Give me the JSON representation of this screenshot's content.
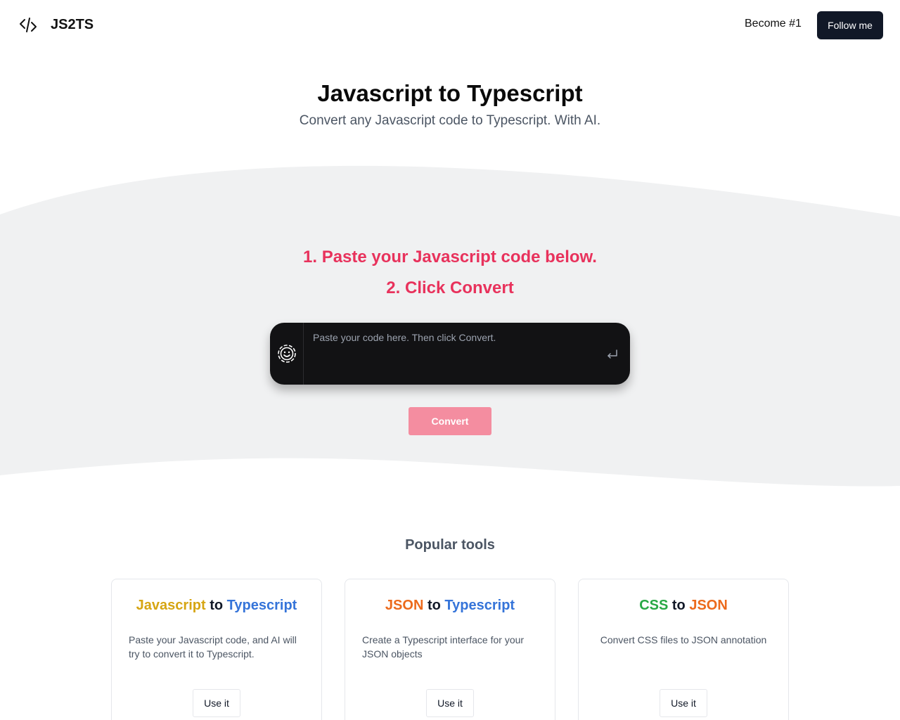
{
  "header": {
    "logo_text": "JS2TS",
    "nav_link": "Become #1",
    "follow_label": "Follow me",
    "follow_bg": "#111827"
  },
  "hero": {
    "title": "Javascript to Typescript",
    "subtitle": "Convert any Javascript code to Typescript. With AI."
  },
  "instructions": {
    "step1": "1. Paste your Javascript code below.",
    "step2": "2. Click Convert",
    "color": "#e8325c"
  },
  "editor": {
    "placeholder": "Paste your code here. Then click Convert.",
    "value": "",
    "left_icon": "smile-icon",
    "submit_icon": "enter-icon"
  },
  "convert": {
    "label": "Convert",
    "bg": "#f48da0"
  },
  "band_color": "#f0f1f2",
  "popular": {
    "title": "Popular tools",
    "cards": [
      {
        "from": "Javascript",
        "from_color": "#d6a512",
        "to_word": "to",
        "target": "Typescript",
        "target_color": "#3574d9",
        "desc": "Paste your Javascript code, and AI will try to convert it to Typescript.",
        "button": "Use it"
      },
      {
        "from": "JSON",
        "from_color": "#ec6a1c",
        "to_word": "to",
        "target": "Typescript",
        "target_color": "#3574d9",
        "desc": "Create a Typescript interface for your JSON objects",
        "button": "Use it"
      },
      {
        "from": "CSS",
        "from_color": "#27a844",
        "to_word": "to",
        "target": "JSON",
        "target_color": "#ec6a1c",
        "desc": "Convert CSS files to JSON annotation",
        "button": "Use it"
      }
    ]
  }
}
